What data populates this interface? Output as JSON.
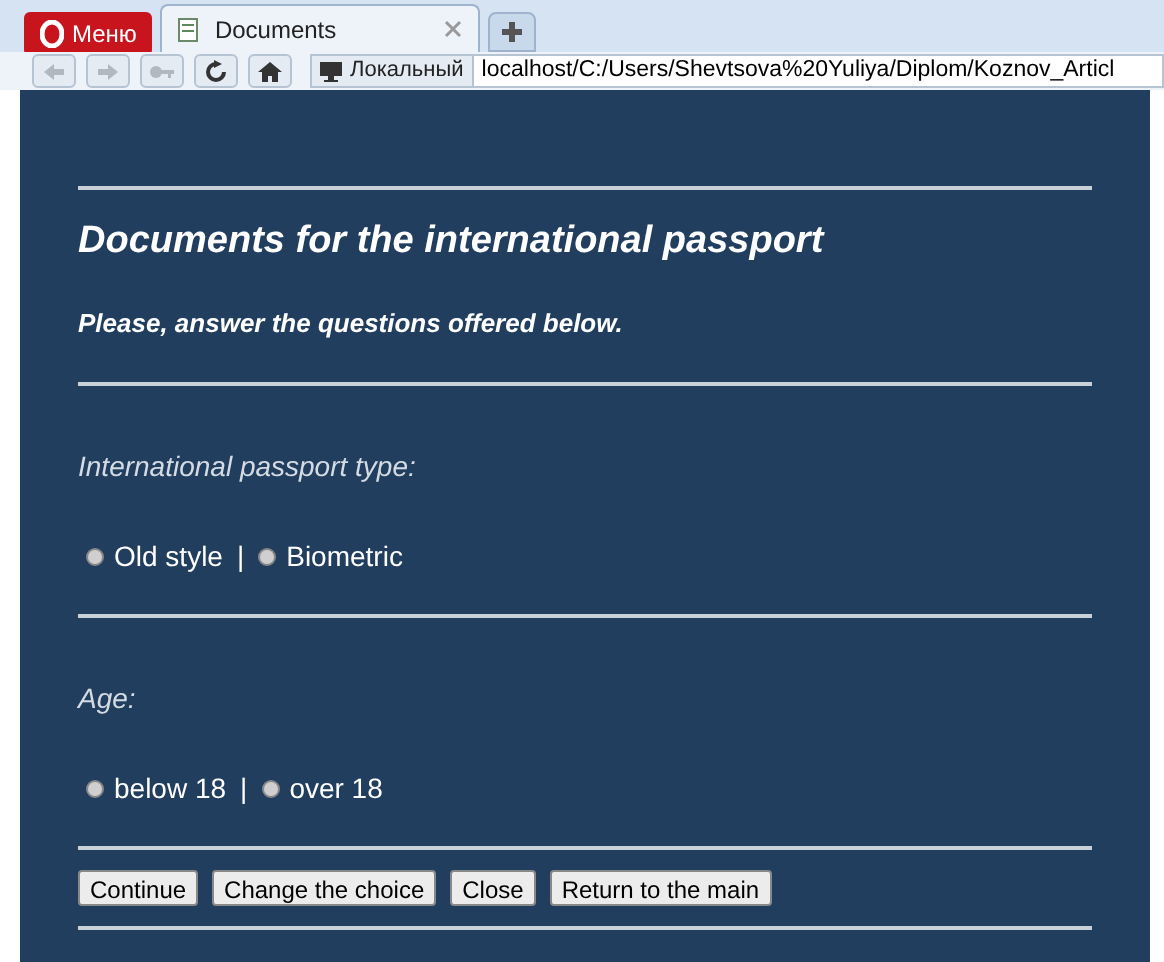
{
  "browser": {
    "menu_label": "Меню",
    "tabs": [
      {
        "title": "Documents",
        "selected": true
      }
    ],
    "toolbar": [
      {
        "kind": "back",
        "disabled": true
      },
      {
        "kind": "forward",
        "disabled": true
      },
      {
        "kind": "key",
        "disabled": true
      },
      {
        "kind": "reload",
        "disabled": false
      },
      {
        "kind": "home",
        "disabled": false
      }
    ],
    "address": {
      "badge": "Локальный",
      "url": "localhost/C:/Users/Shevtsova%20Yuliya/Diplom/Koznov_Articl"
    }
  },
  "page": {
    "title": "Documents for the international passport",
    "subtitle": "Please, answer the questions offered below.",
    "questions": [
      {
        "label": "International passport type:",
        "separator": "|",
        "options": [
          {
            "label": "Old style",
            "selected": false
          },
          {
            "label": "Biometric",
            "selected": false
          }
        ]
      },
      {
        "label": "Age:",
        "separator": "|",
        "options": [
          {
            "label": "below 18",
            "selected": false
          },
          {
            "label": "over 18",
            "selected": false
          }
        ]
      }
    ],
    "buttons": [
      "Continue",
      "Change the choice",
      "Close",
      "Return to the main"
    ]
  }
}
